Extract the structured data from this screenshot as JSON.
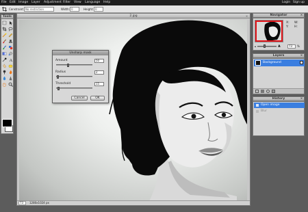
{
  "menu": {
    "items": [
      "File",
      "Edit",
      "Image",
      "Layer",
      "Adjustment",
      "Filter",
      "View",
      "Language",
      "Help"
    ],
    "login": "Login",
    "signup": "Sign up"
  },
  "options": {
    "constraint_label": "Constraint:",
    "constraint_value": "No restriction",
    "width_label": "Width:",
    "width_value": "0",
    "height_label": "Height:",
    "height_value": "0"
  },
  "tools": {
    "title": "Tools"
  },
  "document": {
    "title": "2.jpg",
    "zoom": "73",
    "dimensions": "1280x1024 px"
  },
  "dialog": {
    "title": "Unsharp mask",
    "amount_label": "Amount",
    "amount_value": "50",
    "amount_level": 0.33,
    "radius_label": "Radius",
    "radius_value": "2",
    "radius_level": 0.04,
    "threshold_label": "Threshold",
    "threshold_value": "15",
    "threshold_level": 0.06,
    "cancel_label": "Cancel",
    "ok_label": "OK"
  },
  "navigator": {
    "title": "Navigator",
    "x_label": "X:",
    "y_label": "Y:",
    "w_label": "W:",
    "h_label": "H:",
    "zoom_value": "73",
    "zoom_unit": "%"
  },
  "layers": {
    "title": "Layers",
    "items": [
      {
        "name": "Background",
        "selected": true
      }
    ]
  },
  "history": {
    "title": "History",
    "items": [
      {
        "name": "Open image",
        "selected": true
      },
      {
        "name": "Blur",
        "selected": false
      }
    ]
  },
  "colors": {
    "selection": "#3a7ee0",
    "accent_red": "#e2141a"
  },
  "icons": [
    "marquee-icon",
    "move-icon",
    "crop-icon",
    "lasso-icon",
    "wand-icon",
    "pencil-icon",
    "brush-icon",
    "clone-icon",
    "color-replace-icon",
    "drawing-icon",
    "gradient-icon",
    "bucket-icon",
    "picker-icon",
    "type-icon",
    "smudge-icon",
    "sponge-icon",
    "dodge-icon",
    "burn-icon",
    "blur-icon",
    "sharpen-icon",
    "hand-icon",
    "zoom-icon"
  ]
}
